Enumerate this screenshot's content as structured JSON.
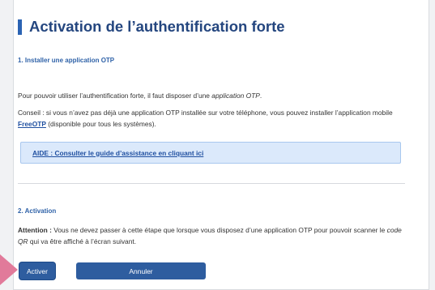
{
  "page": {
    "title": "Activation de l’authentification forte"
  },
  "section1": {
    "heading": "1. Installer une application OTP",
    "intro_text": "Pour pouvoir utiliser l’authentification forte, il faut disposer d’une ",
    "intro_emphasis": "application OTP",
    "intro_end": ".",
    "advice_text": "Conseil : si vous n’avez pas déjà une application OTP installée sur votre téléphone, vous pouvez installer l’application mobile ",
    "advice_link": "FreeOTP",
    "advice_end": " (disponible pour tous les systèmes).",
    "help_link": "AIDE : Consulter le guide d’assistance en cliquant ici"
  },
  "section2": {
    "heading": "2. Activation",
    "attention_label": "Attention :",
    "attention_text1": " Vous ne devez passer à cette étape que lorsque vous disposez d’une application OTP pour pouvoir scanner le ",
    "attention_emphasis": "code QR",
    "attention_text2": " qui va être affiché à l’écran suivant."
  },
  "actions": {
    "activate_label": "Activer",
    "cancel_label": "Annuler"
  },
  "colors": {
    "accent": "#2b63b3",
    "heading": "#24467f",
    "help_bg": "#dbe9fb",
    "button": "#2e5d9f",
    "pointer": "#e17a9a"
  }
}
